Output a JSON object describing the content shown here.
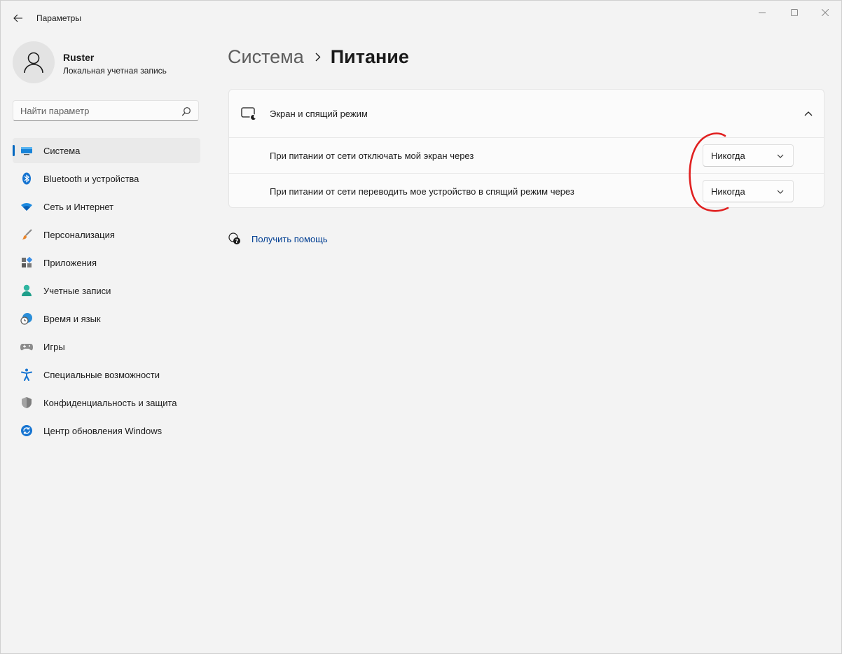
{
  "window": {
    "title": "Параметры"
  },
  "user": {
    "name": "Ruster",
    "account_type": "Локальная учетная запись"
  },
  "search": {
    "placeholder": "Найти параметр",
    "value": ""
  },
  "sidebar": {
    "items": [
      {
        "label": "Система",
        "icon": "system-display-icon",
        "active": true
      },
      {
        "label": "Bluetooth и устройства",
        "icon": "bluetooth-icon",
        "active": false
      },
      {
        "label": "Сеть и Интернет",
        "icon": "wifi-icon",
        "active": false
      },
      {
        "label": "Персонализация",
        "icon": "paintbrush-icon",
        "active": false
      },
      {
        "label": "Приложения",
        "icon": "apps-icon",
        "active": false
      },
      {
        "label": "Учетные записи",
        "icon": "accounts-icon",
        "active": false
      },
      {
        "label": "Время и язык",
        "icon": "time-language-icon",
        "active": false
      },
      {
        "label": "Игры",
        "icon": "gamepad-icon",
        "active": false
      },
      {
        "label": "Специальные возможности",
        "icon": "accessibility-icon",
        "active": false
      },
      {
        "label": "Конфиденциальность и защита",
        "icon": "shield-icon",
        "active": false
      },
      {
        "label": "Центр обновления Windows",
        "icon": "windows-update-icon",
        "active": false
      }
    ]
  },
  "breadcrumb": {
    "parent": "Система",
    "current": "Питание"
  },
  "screen_sleep": {
    "title": "Экран и спящий режим",
    "expanded": true,
    "rows": [
      {
        "label": "При питании от сети отключать мой экран через",
        "value": "Никогда"
      },
      {
        "label": "При питании от сети переводить мое устройство в спящий режим через",
        "value": "Никогда"
      }
    ]
  },
  "help": {
    "label": "Получить помощь"
  },
  "colors": {
    "accent": "#0067c0",
    "link": "#003e92",
    "annotation": "#e02020"
  }
}
